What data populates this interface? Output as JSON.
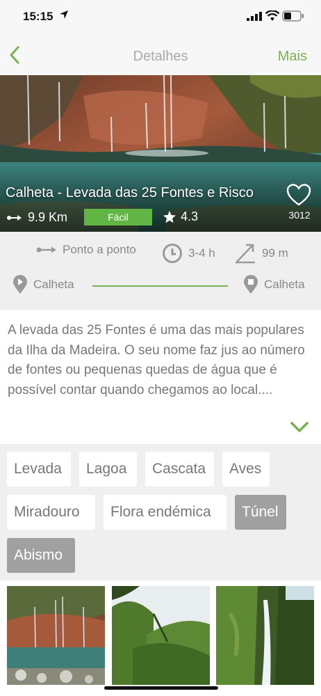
{
  "status_bar": {
    "time": "15:15"
  },
  "nav": {
    "title": "Detalhes",
    "more_label": "Mais"
  },
  "hero": {
    "trail_name": "Calheta - Levada das 25 Fontes e Risco",
    "distance": "9.9 Km",
    "difficulty": "Fácil",
    "rating": "4.3",
    "likes": "3012"
  },
  "info": {
    "route_type": "Ponto a ponto",
    "duration": "3-4 h",
    "elevation": "99 m",
    "start": "Calheta",
    "end": "Calheta"
  },
  "description": {
    "text": "A levada das 25 Fontes é uma das mais populares da Ilha da Madeira. O seu nome faz jus ao número de fontes ou pequenas quedas de água que é possível contar quando chegamos ao local...."
  },
  "tags": [
    {
      "label": "Levada",
      "selected": false
    },
    {
      "label": "Lagoa",
      "selected": false
    },
    {
      "label": "Cascata",
      "selected": false
    },
    {
      "label": "Aves",
      "selected": false
    },
    {
      "label": "Miradouro",
      "selected": false
    },
    {
      "label": "Flora endémica",
      "selected": false
    },
    {
      "label": "Túnel",
      "selected": true
    },
    {
      "label": "Abismo",
      "selected": true
    }
  ],
  "colors": {
    "accent": "#7ab150",
    "badge": "#61b544",
    "tag_selected": "#a0a0a0"
  }
}
